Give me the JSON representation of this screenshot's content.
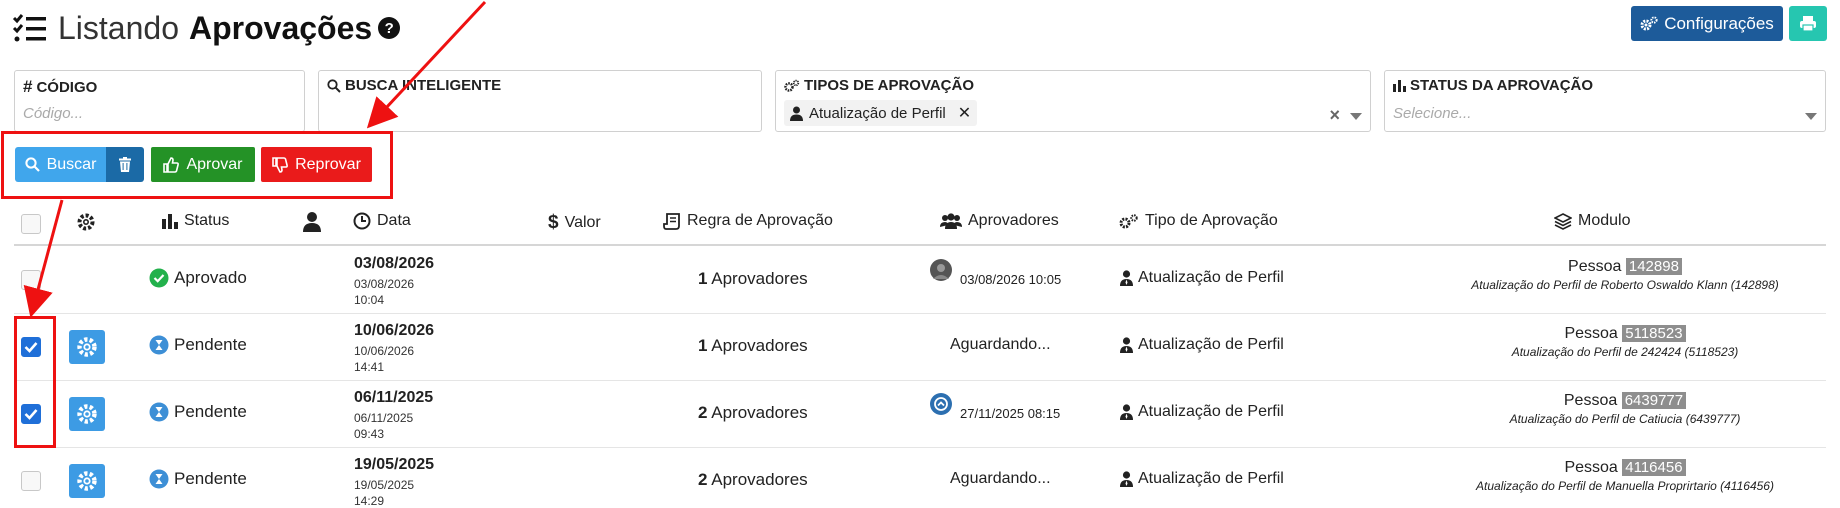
{
  "header": {
    "title_light": "Listando",
    "title_bold": "Aprovações",
    "help": "?"
  },
  "toolbar": {
    "config_label": "Configurações",
    "print_icon": "printer-icon"
  },
  "filters": {
    "codigo": {
      "label": "CÓDIGO",
      "placeholder": "Código..."
    },
    "busca": {
      "label": "BUSCA INTELIGENTE",
      "value": ""
    },
    "tipos": {
      "label": "TIPOS DE APROVAÇÃO",
      "chip": "Atualização de Perfil",
      "chip_remove": "✕",
      "clear": "×"
    },
    "status": {
      "label": "STATUS DA APROVAÇÃO",
      "placeholder": "Selecione..."
    }
  },
  "actions": {
    "buscar": "Buscar",
    "aprovar": "Aprovar",
    "reprovar": "Reprovar"
  },
  "table": {
    "headers": {
      "status": "Status",
      "data": "Data",
      "valor": "Valor",
      "regra": "Regra de Aprovação",
      "aprovadores": "Aprovadores",
      "tipo": "Tipo de Aprovação",
      "modulo": "Modulo"
    },
    "rows": [
      {
        "checked": false,
        "status": "Aprovado",
        "status_color": "#22b14c",
        "date": "03/08/2026",
        "date_sub": "03/08/2026",
        "time": "10:04",
        "rule_n": "1",
        "rule_label": "Aprovadores",
        "approver": "03/08/2026 10:05",
        "approver_avatar": true,
        "tipo": "Atualização de Perfil",
        "mod_title": "Pessoa",
        "mod_id": "142898",
        "mod_sub": "Atualização do Perfil de Roberto Oswaldo Klann (142898)"
      },
      {
        "checked": true,
        "status": "Pendente",
        "status_color": "#3d8fd6",
        "date": "10/06/2026",
        "date_sub": "10/06/2026",
        "time": "14:41",
        "rule_n": "1",
        "rule_label": "Aprovadores",
        "approver": "Aguardando...",
        "approver_avatar": false,
        "tipo": "Atualização de Perfil",
        "mod_title": "Pessoa",
        "mod_id": "5118523",
        "mod_sub": "Atualização do Perfil de 242424 (5118523)"
      },
      {
        "checked": true,
        "status": "Pendente",
        "status_color": "#3d8fd6",
        "date": "06/11/2025",
        "date_sub": "06/11/2025",
        "time": "09:43",
        "rule_n": "2",
        "rule_label": "Aprovadores",
        "approver": "27/11/2025 08:15",
        "approver_avatar": true,
        "tipo": "Atualização de Perfil",
        "mod_title": "Pessoa",
        "mod_id": "6439777",
        "mod_sub": "Atualização do Perfil de Catiucia (6439777)"
      },
      {
        "checked": false,
        "status": "Pendente",
        "status_color": "#3d8fd6",
        "date": "19/05/2025",
        "date_sub": "19/05/2025",
        "time": "14:29",
        "rule_n": "2",
        "rule_label": "Aprovadores",
        "approver": "Aguardando...",
        "approver_avatar": false,
        "tipo": "Atualização de Perfil",
        "mod_title": "Pessoa",
        "mod_id": "4116456",
        "mod_sub": "Atualização do Perfil de Manuella Proprirtario (4116456)"
      }
    ]
  },
  "colors": {
    "config_btn": "#1d5b9a",
    "buscar_btn": "#40a6ec",
    "aprovar_btn": "#249226",
    "reprovar_btn": "#ea1b1b",
    "annotation": "#ee1111"
  }
}
